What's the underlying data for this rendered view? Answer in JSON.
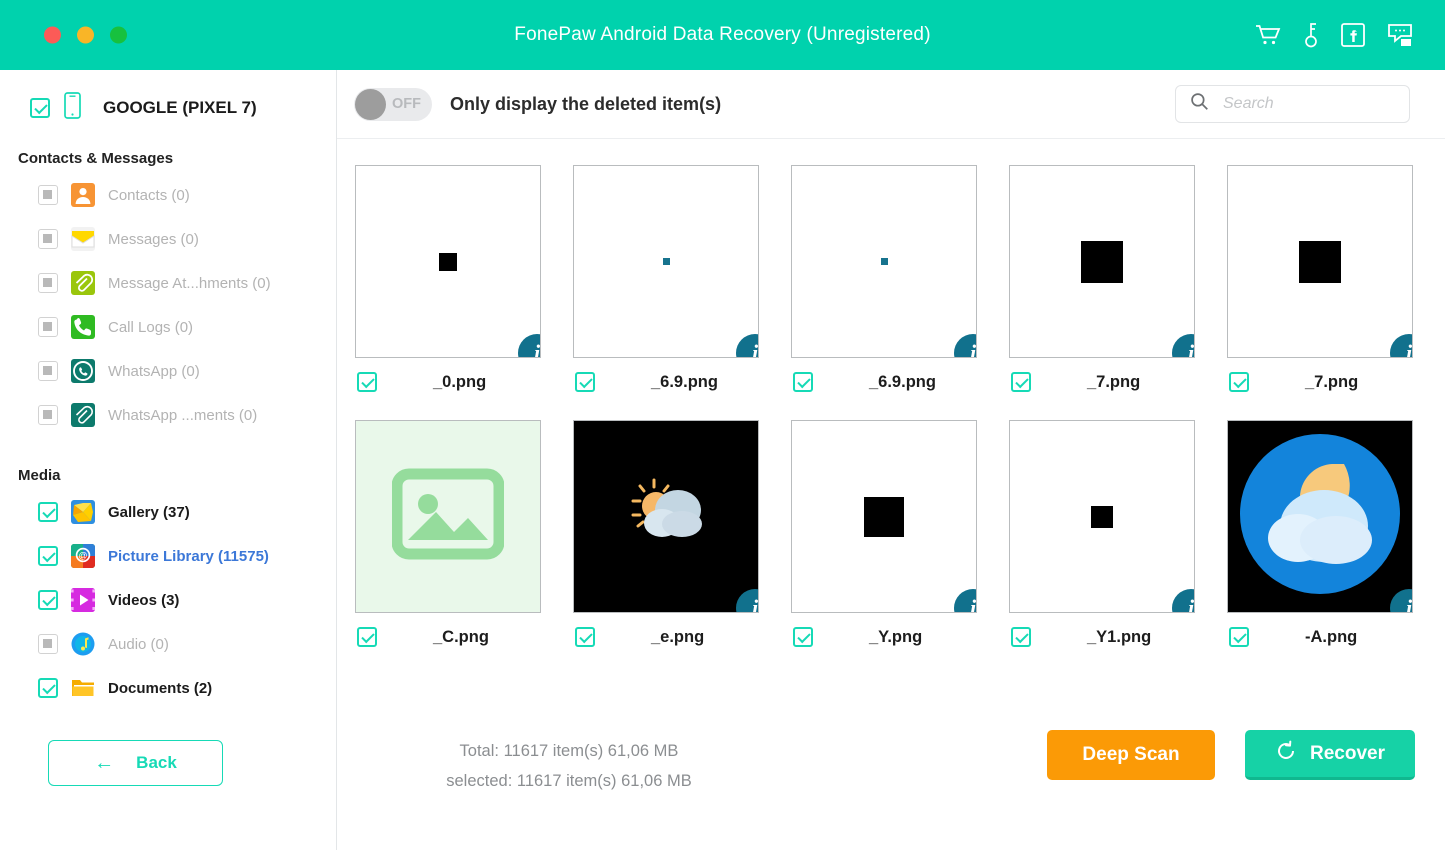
{
  "titlebar": {
    "title": "FonePaw Android Data Recovery (Unregistered)",
    "brand_color": "#00d2ad",
    "window_controls": [
      "close",
      "minimize",
      "maximize"
    ],
    "actions": [
      {
        "name": "cart-icon",
        "label": "Cart"
      },
      {
        "name": "key-icon",
        "label": "Register"
      },
      {
        "name": "facebook-icon",
        "label": "Facebook"
      },
      {
        "name": "feedback-icon",
        "label": "Feedback"
      }
    ]
  },
  "sidebar": {
    "device": {
      "name": "GOOGLE (PIXEL 7)",
      "checked": true,
      "icon": "phone-icon"
    },
    "groups": [
      {
        "title": "Contacts & Messages",
        "items": [
          {
            "label": "Contacts (0)",
            "icon": "contacts-icon",
            "checked": false,
            "disabled": true,
            "active": false
          },
          {
            "label": "Messages (0)",
            "icon": "messages-icon",
            "checked": false,
            "disabled": true,
            "active": false
          },
          {
            "label": "Message At...hments (0)",
            "icon": "message-attachments-icon",
            "checked": false,
            "disabled": true,
            "active": false
          },
          {
            "label": "Call Logs (0)",
            "icon": "call-logs-icon",
            "checked": false,
            "disabled": true,
            "active": false
          },
          {
            "label": "WhatsApp (0)",
            "icon": "whatsapp-icon",
            "checked": false,
            "disabled": true,
            "active": false
          },
          {
            "label": "WhatsApp ...ments (0)",
            "icon": "whatsapp-attachments-icon",
            "checked": false,
            "disabled": true,
            "active": false
          }
        ]
      },
      {
        "title": "Media",
        "items": [
          {
            "label": "Gallery (37)",
            "icon": "gallery-icon",
            "checked": true,
            "disabled": false,
            "active": false
          },
          {
            "label": "Picture Library (11575)",
            "icon": "picture-library-icon",
            "checked": true,
            "disabled": false,
            "active": true
          },
          {
            "label": "Videos (3)",
            "icon": "videos-icon",
            "checked": true,
            "disabled": false,
            "active": false
          },
          {
            "label": "Audio (0)",
            "icon": "audio-icon",
            "checked": false,
            "disabled": true,
            "active": false
          },
          {
            "label": "Documents (2)",
            "icon": "documents-icon",
            "checked": true,
            "disabled": false,
            "active": false
          }
        ]
      }
    ],
    "back_button": {
      "label": "Back",
      "icon": "arrow-left-icon"
    }
  },
  "toolbar": {
    "toggle": {
      "state": "OFF",
      "on": false
    },
    "toggle_label": "Only display the deleted item(s)",
    "search": {
      "value": "",
      "placeholder": "Search",
      "icon": "search-icon"
    }
  },
  "grid": {
    "items": [
      {
        "name": "_0.png",
        "checked": true,
        "thumb": "black-square",
        "square_size": 18,
        "bg": "white",
        "info": true
      },
      {
        "name": "_6.9.png",
        "checked": true,
        "thumb": "teal-square",
        "square_size": 7,
        "bg": "white",
        "info": true
      },
      {
        "name": "_6.9.png",
        "checked": true,
        "thumb": "teal-square",
        "square_size": 7,
        "bg": "white",
        "info": true
      },
      {
        "name": "_7.png",
        "checked": true,
        "thumb": "black-square",
        "square_size": 42,
        "bg": "white",
        "info": true
      },
      {
        "name": "_7.png",
        "checked": true,
        "thumb": "black-square",
        "square_size": 42,
        "bg": "white",
        "info": true
      },
      {
        "name": "_C.png",
        "checked": true,
        "thumb": "image-placeholder",
        "bg": "mint",
        "info": false
      },
      {
        "name": "_e.png",
        "checked": true,
        "thumb": "sun-cloud",
        "bg": "black",
        "info": true
      },
      {
        "name": "_Y.png",
        "checked": true,
        "thumb": "black-square",
        "square_size": 40,
        "bg": "white",
        "info": true
      },
      {
        "name": "_Y1.png",
        "checked": true,
        "thumb": "black-square",
        "square_size": 22,
        "bg": "white",
        "info": true
      },
      {
        "name": "-A.png",
        "checked": true,
        "thumb": "moon-cloud",
        "bg": "black",
        "info": true
      }
    ],
    "info_badge_label": "i"
  },
  "footer": {
    "total_line": "Total: 11617 item(s) 61,06 MB",
    "selected_line": "selected: 11617 item(s) 61,06 MB",
    "deep_scan_label": "Deep Scan",
    "recover_label": "Recover",
    "recover_icon": "refresh-icon",
    "deep_scan_color": "#fb9a06",
    "recover_color": "#16d2a6"
  }
}
